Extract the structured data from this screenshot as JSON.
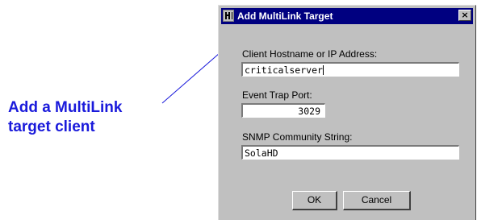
{
  "callout": {
    "line1": "Add a MultiLink",
    "line2": "target client",
    "color": "#1a1adb"
  },
  "dialog": {
    "title": "Add MultiLink Target",
    "icon": "app-icon",
    "close_glyph": "×"
  },
  "fields": {
    "hostname": {
      "label": "Client Hostname or IP Address:",
      "value": "criticalserver"
    },
    "port": {
      "label": "Event Trap Port:",
      "value": "3029"
    },
    "community": {
      "label": "SNMP Community String:",
      "value": "SolaHD"
    }
  },
  "buttons": {
    "ok": "OK",
    "cancel": "Cancel"
  }
}
